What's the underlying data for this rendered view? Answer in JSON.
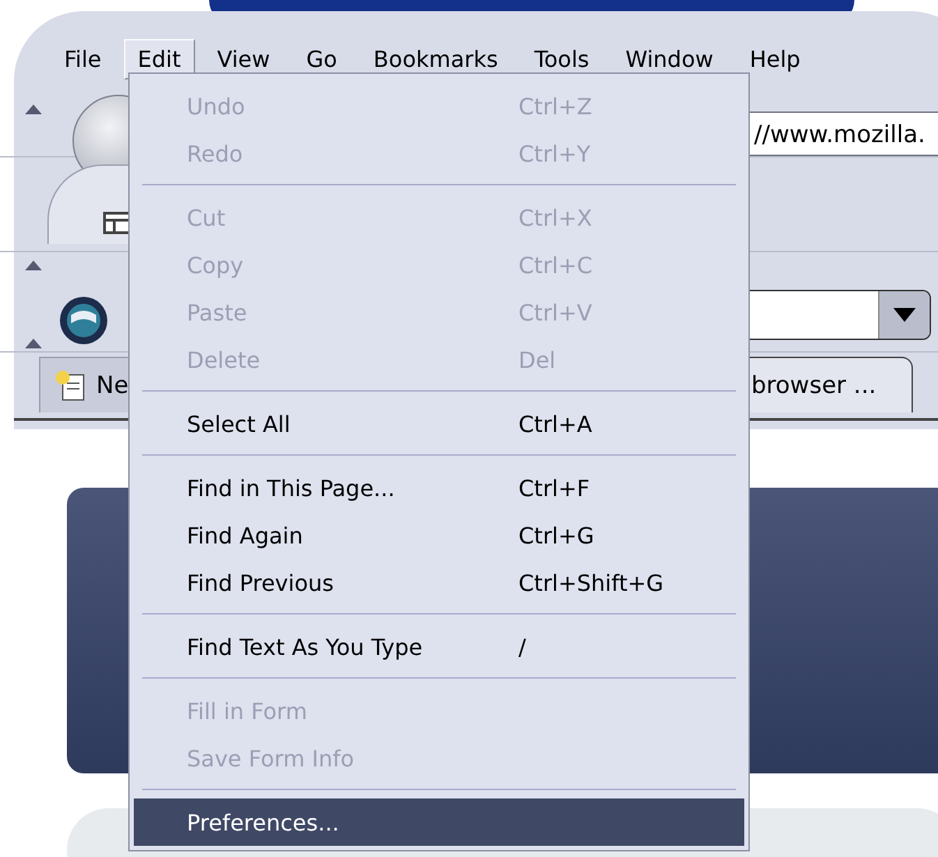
{
  "menu_bar": [
    {
      "label": "File",
      "selected": false
    },
    {
      "label": "Edit",
      "selected": true
    },
    {
      "label": "View",
      "selected": false
    },
    {
      "label": "Go",
      "selected": false
    },
    {
      "label": "Bookmarks",
      "selected": false
    },
    {
      "label": "Tools",
      "selected": false
    },
    {
      "label": "Window",
      "selected": false
    },
    {
      "label": "Help",
      "selected": false
    }
  ],
  "address_bar": {
    "value": "//www.mozilla."
  },
  "tabs": [
    {
      "label": "Ne",
      "selected": false
    },
    {
      "label": "browser ...",
      "selected": true
    }
  ],
  "edit_menu": [
    {
      "kind": "item",
      "label": "Undo",
      "shortcut": "Ctrl+Z",
      "disabled": true,
      "selected": false
    },
    {
      "kind": "item",
      "label": "Redo",
      "shortcut": "Ctrl+Y",
      "disabled": true,
      "selected": false
    },
    {
      "kind": "separator"
    },
    {
      "kind": "item",
      "label": "Cut",
      "shortcut": "Ctrl+X",
      "disabled": true,
      "selected": false
    },
    {
      "kind": "item",
      "label": "Copy",
      "shortcut": "Ctrl+C",
      "disabled": true,
      "selected": false
    },
    {
      "kind": "item",
      "label": "Paste",
      "shortcut": "Ctrl+V",
      "disabled": true,
      "selected": false
    },
    {
      "kind": "item",
      "label": "Delete",
      "shortcut": "Del",
      "disabled": true,
      "selected": false
    },
    {
      "kind": "separator"
    },
    {
      "kind": "item",
      "label": "Select All",
      "shortcut": "Ctrl+A",
      "disabled": false,
      "selected": false
    },
    {
      "kind": "separator"
    },
    {
      "kind": "item",
      "label": "Find in This Page...",
      "shortcut": "Ctrl+F",
      "disabled": false,
      "selected": false
    },
    {
      "kind": "item",
      "label": "Find Again",
      "shortcut": "Ctrl+G",
      "disabled": false,
      "selected": false
    },
    {
      "kind": "item",
      "label": "Find Previous",
      "shortcut": "Ctrl+Shift+G",
      "disabled": false,
      "selected": false
    },
    {
      "kind": "separator"
    },
    {
      "kind": "item",
      "label": "Find Text As You Type",
      "shortcut": "/",
      "disabled": false,
      "selected": false
    },
    {
      "kind": "separator"
    },
    {
      "kind": "item",
      "label": "Fill in Form",
      "disabled": true,
      "selected": false
    },
    {
      "kind": "item",
      "label": "Save Form Info",
      "disabled": true,
      "selected": false
    },
    {
      "kind": "separator"
    },
    {
      "kind": "item",
      "label": "Preferences...",
      "disabled": false,
      "selected": true
    }
  ]
}
